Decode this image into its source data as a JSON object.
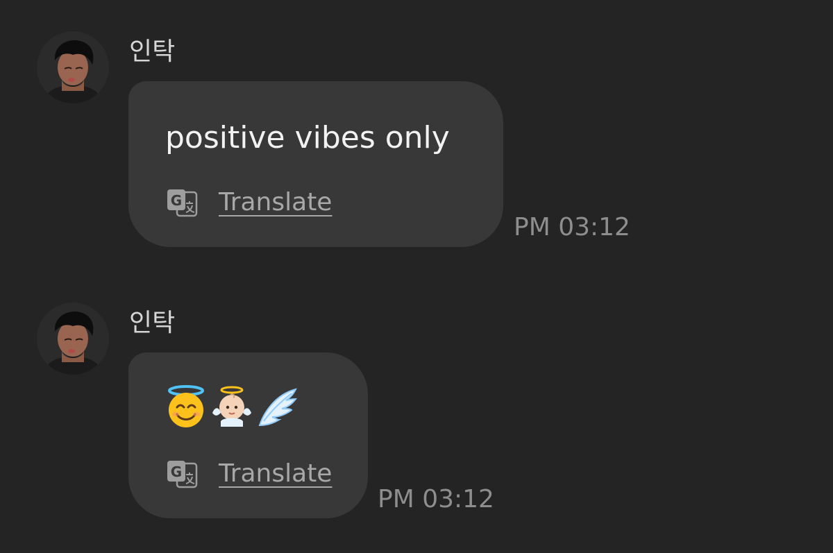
{
  "messages": [
    {
      "sender": "인탁",
      "text": "positive vibes only",
      "translate_label": "Translate",
      "time": "PM 03:12",
      "avatar_icon": "profile-photo"
    },
    {
      "sender": "인탁",
      "emojis": [
        "smiling-face-with-halo",
        "baby-angel",
        "wing"
      ],
      "translate_label": "Translate",
      "time": "PM 03:12",
      "avatar_icon": "profile-photo"
    }
  ],
  "colors": {
    "background": "#242424",
    "bubble": "#383838",
    "message_text": "#f2f2f2",
    "sender_text": "#d6d6d6",
    "translate_text": "#a8a8a8",
    "time_text": "#8e8e8e"
  }
}
